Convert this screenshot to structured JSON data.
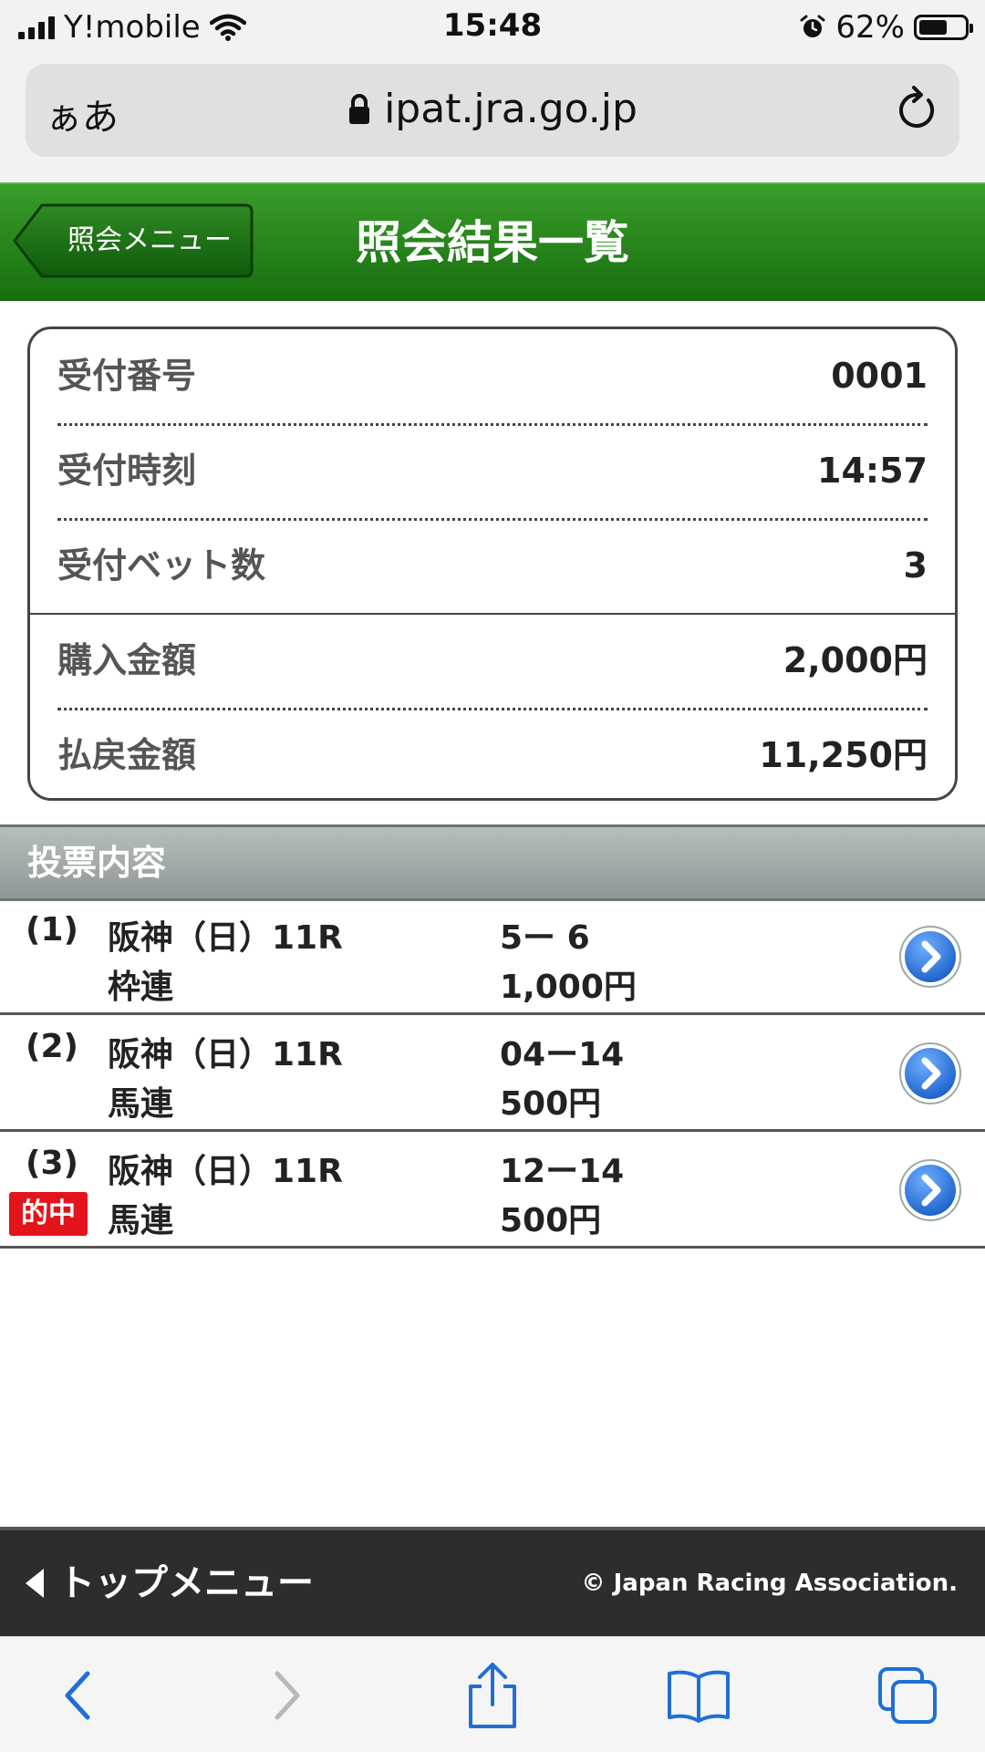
{
  "status_bar": {
    "carrier": "Y!mobile",
    "time": "15:48",
    "battery": "62%",
    "battery_level": 0.62
  },
  "browser": {
    "aa_label": "ぁあ",
    "url": "ipat.jra.go.jp"
  },
  "header": {
    "back_label": "照会メニュー",
    "title": "照会結果一覧"
  },
  "summary": {
    "rows": [
      {
        "label": "受付番号",
        "value": "0001"
      },
      {
        "label": "受付時刻",
        "value": "14:57"
      },
      {
        "label": "受付ベット数",
        "value": "3"
      },
      {
        "label": "購入金額",
        "value": "2,000円"
      },
      {
        "label": "払戻金額",
        "value": "11,250円"
      }
    ]
  },
  "bets_section": {
    "title": "投票内容",
    "items": [
      {
        "num": "(1)",
        "race": "阪神（日）11R",
        "type": "枠連",
        "combo": "5ー 6",
        "amount": "1,000円",
        "hit": ""
      },
      {
        "num": "(2)",
        "race": "阪神（日）11R",
        "type": "馬連",
        "combo": "04ー14",
        "amount": "500円",
        "hit": ""
      },
      {
        "num": "(3)",
        "race": "阪神（日）11R",
        "type": "馬連",
        "combo": "12ー14",
        "amount": "500円",
        "hit": "的中"
      }
    ]
  },
  "footer": {
    "top_menu": "トップメニュー",
    "copyright": "© Japan Racing Association."
  },
  "colors": {
    "header_green": "#2c8a1f",
    "accent_blue": "#1f6fd6",
    "hit_red": "#e3141b",
    "footer_dark": "#2d2d2d"
  }
}
